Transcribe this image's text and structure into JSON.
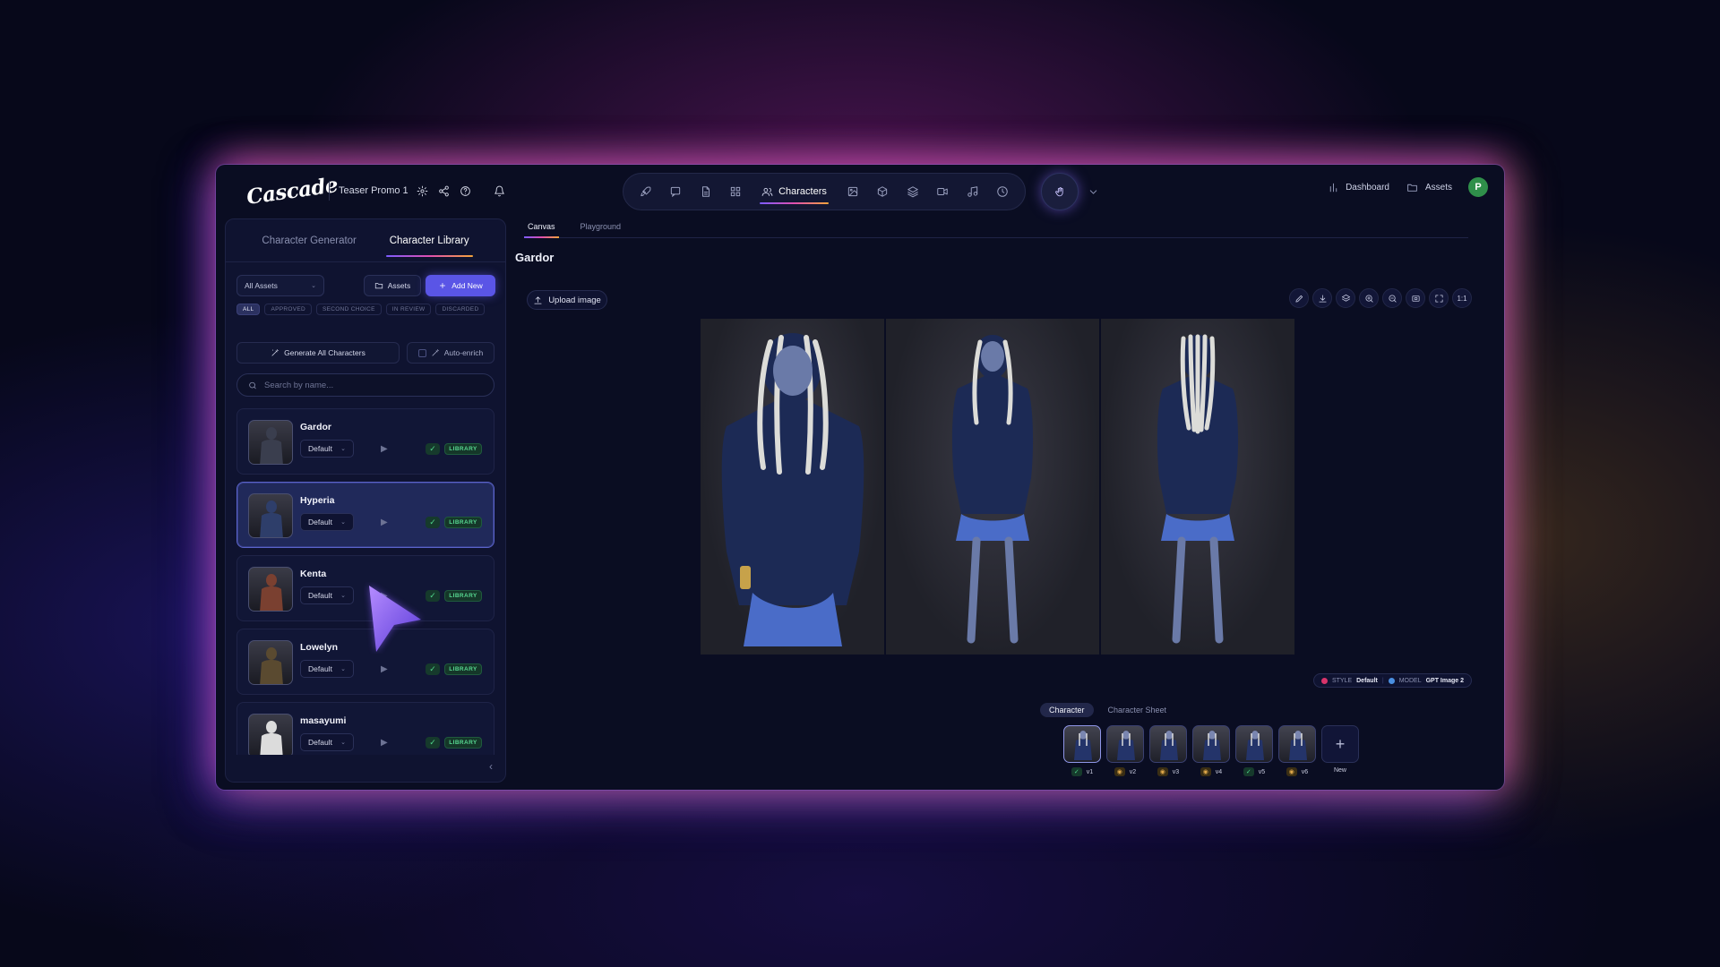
{
  "app": {
    "logo": "Cascade",
    "project_name": "Teaser Promo 1"
  },
  "nav": {
    "icons": [
      "rocket-icon",
      "chat-icon",
      "document-icon",
      "grid-icon"
    ],
    "active_label": "Characters",
    "icons_after": [
      "image-icon",
      "cube-icon",
      "layers-icon",
      "video-icon",
      "music-icon",
      "clock-icon"
    ]
  },
  "right_nav": {
    "dashboard": "Dashboard",
    "assets": "Assets",
    "avatar_initial": "P",
    "avatar_color": "#2f8f4a"
  },
  "sidebar": {
    "tabs": [
      "Character Generator",
      "Character Library"
    ],
    "active_tab": "Character Library",
    "asset_filter": "All Assets",
    "assets_button": "Assets",
    "add_new_button": "Add New",
    "filters": [
      "ALL",
      "APPROVED",
      "SECOND CHOICE",
      "IN REVIEW",
      "DISCARDED"
    ],
    "generate_all": "Generate All Characters",
    "auto_enrich": "Auto-enrich",
    "search_placeholder": "Search by name...",
    "characters": [
      {
        "name": "Gardor",
        "variant": "Default",
        "badge": "LIBRARY",
        "selected": false,
        "tone": "#3a3e4e"
      },
      {
        "name": "Hyperia",
        "variant": "Default",
        "badge": "LIBRARY",
        "selected": true,
        "tone": "#2e3e6a"
      },
      {
        "name": "Kenta",
        "variant": "Default",
        "badge": "LIBRARY",
        "selected": false,
        "tone": "#7a4030"
      },
      {
        "name": "Lowelyn",
        "variant": "Default",
        "badge": "LIBRARY",
        "selected": false,
        "tone": "#5a4a30"
      },
      {
        "name": "masayumi",
        "variant": "Default",
        "badge": "LIBRARY",
        "selected": false,
        "tone": "#dcdcdc"
      }
    ]
  },
  "main": {
    "tabs": [
      "Canvas",
      "Playground"
    ],
    "active_tab": "Canvas",
    "title": "Gardor",
    "upload_button": "Upload image",
    "zoom_label": "1:1",
    "meta": {
      "style_label": "STYLE",
      "style_value": "Default",
      "model_label": "MODEL",
      "model_value": "GPT Image 2"
    },
    "view_tabs": [
      "Character",
      "Character Sheet"
    ],
    "active_view_tab": "Character",
    "versions": [
      {
        "label": "v1",
        "status": "approved"
      },
      {
        "label": "v2",
        "status": "review"
      },
      {
        "label": "v3",
        "status": "review"
      },
      {
        "label": "v4",
        "status": "review"
      },
      {
        "label": "v5",
        "status": "approved"
      },
      {
        "label": "v6",
        "status": "review"
      }
    ],
    "new_label": "New"
  },
  "colors": {
    "accent": "#5a55e6",
    "library_green": "#57d891",
    "review_amber": "#e0a84a"
  }
}
